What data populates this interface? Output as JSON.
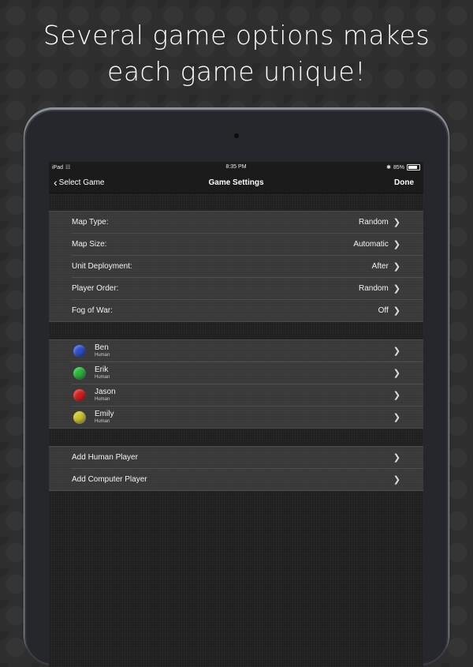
{
  "headline": {
    "line1": "Several game options makes",
    "line2": "each game unique!"
  },
  "status_bar": {
    "device": "iPad",
    "wifi_icon": "wifi-icon",
    "time": "8:35 PM",
    "bluetooth_icon": "bluetooth-icon",
    "battery_percent": "85%",
    "battery_level": 0.85
  },
  "nav": {
    "back_label": "Select Game",
    "title": "Game Settings",
    "done_label": "Done"
  },
  "settings": [
    {
      "label": "Map Type:",
      "value": "Random"
    },
    {
      "label": "Map Size:",
      "value": "Automatic"
    },
    {
      "label": "Unit Deployment:",
      "value": "After"
    },
    {
      "label": "Player Order:",
      "value": "Random"
    },
    {
      "label": "Fog of War:",
      "value": "Off"
    }
  ],
  "players": [
    {
      "name": "Ben",
      "type": "Human",
      "color": "#2e4fc9"
    },
    {
      "name": "Erik",
      "type": "Human",
      "color": "#2bb53a"
    },
    {
      "name": "Jason",
      "type": "Human",
      "color": "#d11f1f"
    },
    {
      "name": "Emily",
      "type": "Human",
      "color": "#c8c22e"
    }
  ],
  "actions": [
    {
      "label": "Add Human Player"
    },
    {
      "label": "Add Computer Player"
    }
  ],
  "colors": {
    "background": "#2e2e2e",
    "screen": "#1f1f1f",
    "group": "#3a3a3a",
    "text": "#ffffff"
  }
}
